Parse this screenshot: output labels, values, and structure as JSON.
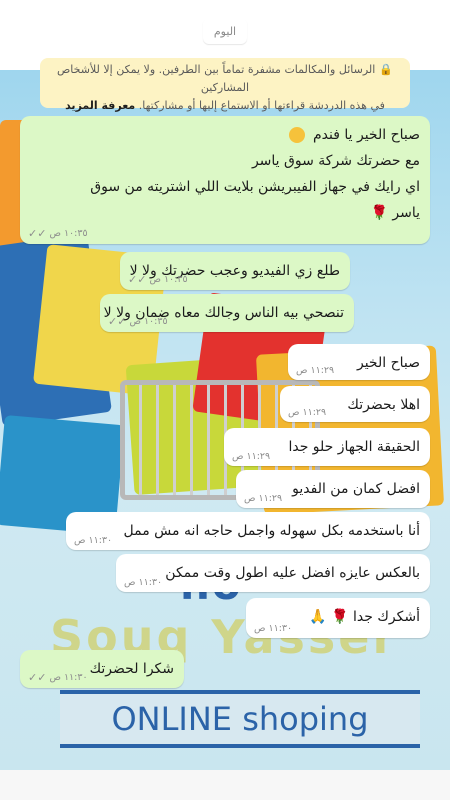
{
  "date_chip": "اليوم",
  "encryption_notice": {
    "icon": "lock-icon",
    "line1": "الرسائل والمكالمات مشفرة تماماً بين الطرفين. ولا يمكن إلا للأشخاص المشاركين",
    "line2_text": "في هذه الدردشة قراءتها أو الاستماع إليها أو مشاركتها.",
    "learn_more": "معرفة المزيد"
  },
  "messages": [
    {
      "id": "m1",
      "direction": "outgoing",
      "lines": [
        "صباح الخير يا فندم",
        "مع حضرتك شركة سوق ياسر",
        "اي رايك في جهاز الفيبريشن بلايت اللي اشتريته من سوق",
        "ياسر"
      ],
      "time": "١٠:٣٥ ص",
      "ticks": "✓✓"
    },
    {
      "id": "m2",
      "direction": "outgoing",
      "lines": [
        "طلع زي الفيديو وعجب حضرتك ولا لا"
      ],
      "time": "١٠:٣٥ ص",
      "ticks": "✓✓"
    },
    {
      "id": "m3",
      "direction": "outgoing",
      "lines": [
        "تنصحي بيه الناس وجالك معاه ضمان ولا لا"
      ],
      "time": "١٠:٣٥ ص",
      "ticks": "✓✓"
    },
    {
      "id": "m4",
      "direction": "incoming",
      "lines": [
        "صباح الخير"
      ],
      "time": "١١:٢٩ ص"
    },
    {
      "id": "m5",
      "direction": "incoming",
      "lines": [
        "اهلا بحضرتك"
      ],
      "time": "١١:٢٩ ص"
    },
    {
      "id": "m6",
      "direction": "incoming",
      "lines": [
        "الحقيقة الجهاز حلو جدا"
      ],
      "time": "١١:٢٩ ص"
    },
    {
      "id": "m7",
      "direction": "incoming",
      "lines": [
        "افضل كمان من الفديو"
      ],
      "time": "١١:٢٩ ص"
    },
    {
      "id": "m8",
      "direction": "incoming",
      "lines": [
        "أنا باستخدمه بكل سهوله واجمل حاجه انه مش ممل"
      ],
      "time": "١١:٣٠ ص"
    },
    {
      "id": "m9",
      "direction": "incoming",
      "lines": [
        "بالعكس عايزه افضل عليه اطول وقت ممكن"
      ],
      "time": "١١:٣٠ ص"
    },
    {
      "id": "m10",
      "direction": "incoming",
      "lines": [
        "أشكرك جدا"
      ],
      "time": "١١:٣٠ ص"
    },
    {
      "id": "m11",
      "direction": "outgoing",
      "lines": [
        "شكرا لحضرتك"
      ],
      "time": "١١:٣٠ ص",
      "ticks": "✓✓"
    }
  ],
  "background": {
    "watermark_partial": "ho",
    "watermark_brand": "Souq Yasser",
    "watermark_tagline": "ONLINE shoping"
  },
  "colors": {
    "outgoing_bubble": "#dcf8c6",
    "incoming_bubble": "#ffffff",
    "notice_bg": "#fdf3c4"
  }
}
